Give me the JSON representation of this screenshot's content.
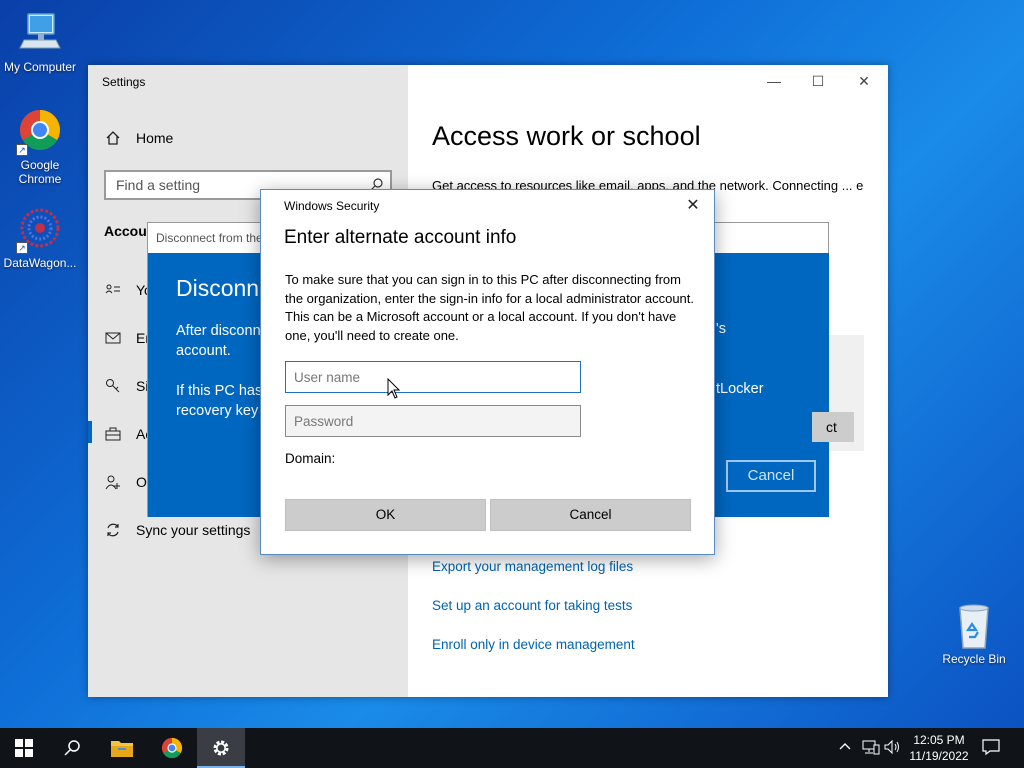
{
  "desktop": {
    "icons": [
      {
        "label": "My Computer"
      },
      {
        "label": "Google Chrome"
      },
      {
        "label": "DataWagon..."
      },
      {
        "label": "Recycle Bin"
      }
    ]
  },
  "settings": {
    "window_title": "Settings",
    "nav": {
      "home": "Home",
      "search_placeholder": "Find a setting",
      "section": "Accoun",
      "items": [
        "Yo",
        "En",
        "Si",
        "Ac",
        "Ot",
        "Sync your settings"
      ]
    },
    "page_title": "Access work or school",
    "page_desc": "Get access to resources like email, apps, and the network. Connecting ... e things on this device, ... ecific info about this",
    "links": [
      "Export your management log files",
      "Set up an account for taking tests",
      "Enroll only in device management"
    ]
  },
  "disconnect": {
    "title": "Disconnect from the",
    "heading": "Disconn",
    "text1": "After disconn",
    "text1b": "account.",
    "text2": "If this PC has",
    "text2b": "recovery key",
    "right1": "'s",
    "right2": "tLocker",
    "ct_label": "ct",
    "cancel_label": "Cancel"
  },
  "security": {
    "app_name": "Windows Security",
    "title": "Enter alternate account info",
    "body": "To make sure that you can sign in to this PC after disconnecting from the organization, enter the sign-in info for a local administrator account. This can be a Microsoft account or a local account. If you don't have one, you'll need to create one.",
    "username_placeholder": "User name",
    "password_placeholder": "Password",
    "domain_label": "Domain:",
    "ok_label": "OK",
    "cancel_label": "Cancel"
  },
  "taskbar": {
    "time": "12:05 PM",
    "date": "11/19/2022"
  }
}
